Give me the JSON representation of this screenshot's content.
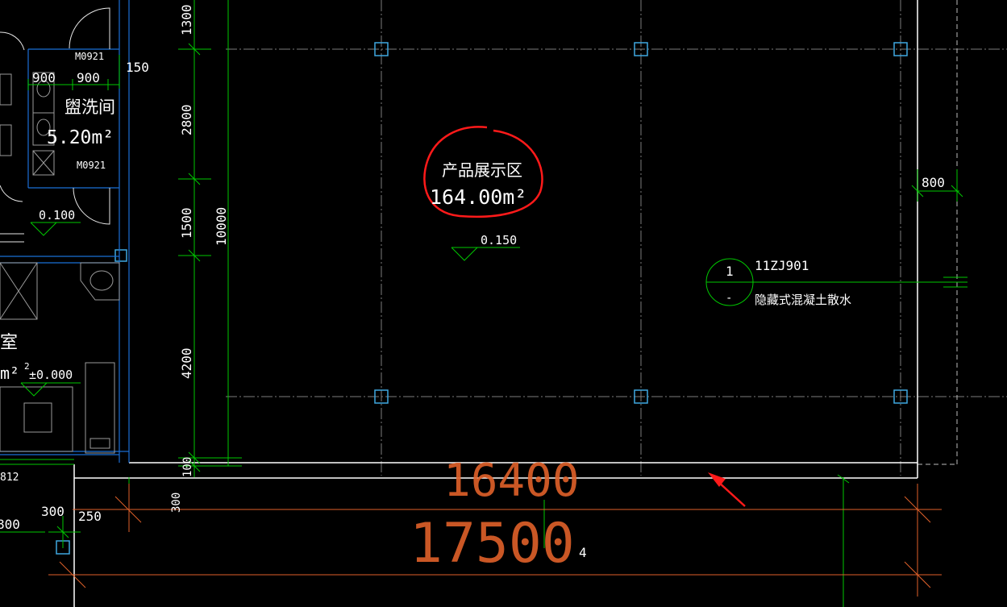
{
  "drawing": {
    "room_main": {
      "name": "产品展示区",
      "area": "164.00m²",
      "level": "0.150"
    },
    "room_washroom": {
      "name": "盥洗间",
      "area": "5.20m²",
      "level": "0.100",
      "door_top": "M0921",
      "door_bottom": "M0921"
    },
    "room_left_partial": {
      "name_fragment": "室",
      "area_fragment": "m²",
      "level": "±0.000"
    },
    "dims_vertical": [
      "1300",
      "2800",
      "1500",
      "4200",
      "100",
      "300",
      "10000"
    ],
    "dims_washroom": {
      "a": "900",
      "b": "900",
      "c": "150"
    },
    "dim_right": "800",
    "dims_bottom": {
      "overall_1": "16400",
      "overall_2": "17500",
      "small_a": "300",
      "small_b": "250",
      "fragment_a": "812",
      "fragment_b": "800",
      "axis_num": "4"
    },
    "detail_callout": {
      "number": "1",
      "sheet": "-",
      "std": "11ZJ901",
      "note": "隐藏式混凝土散水"
    }
  },
  "colors": {
    "background": "#000000",
    "axis_grid": "#7d7d7d",
    "wall": "#ffffff",
    "dimension_green": "#00c800",
    "window_blue": "#1a6fd6",
    "column_cyan": "#3fa7e0",
    "dimension_orange": "#e0612a",
    "annotation_red": "#ff1a1a",
    "text_white": "#ffffff"
  },
  "icons": [
    "column-marker-icon",
    "elevation-marker-icon",
    "washbasin-icon",
    "toilet-icon",
    "shower-icon",
    "door-swing-icon",
    "red-arrow-icon",
    "red-circle-annotation-icon"
  ]
}
